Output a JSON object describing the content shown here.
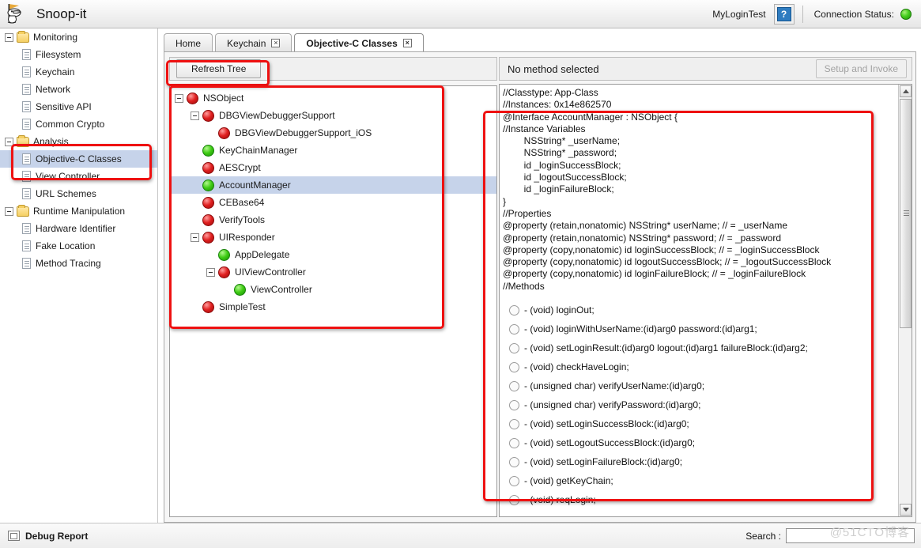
{
  "header": {
    "app_title": "Snoop-it",
    "logo_icon": "snoopy-dog-icon",
    "login_name": "MyLoginTest",
    "help_label": "?",
    "connection_label": "Connection Status:",
    "connection_state_color": "#45cf1e"
  },
  "sidebar": {
    "items": [
      {
        "label": "Monitoring",
        "type": "folder",
        "level": 0,
        "expanded": true,
        "selected": false
      },
      {
        "label": "Filesystem",
        "type": "doc",
        "level": 1,
        "expanded": false,
        "selected": false
      },
      {
        "label": "Keychain",
        "type": "doc",
        "level": 1,
        "expanded": false,
        "selected": false
      },
      {
        "label": "Network",
        "type": "doc",
        "level": 1,
        "expanded": false,
        "selected": false
      },
      {
        "label": "Sensitive API",
        "type": "doc",
        "level": 1,
        "expanded": false,
        "selected": false
      },
      {
        "label": "Common Crypto",
        "type": "doc",
        "level": 1,
        "expanded": false,
        "selected": false
      },
      {
        "label": "Analysis",
        "type": "folder",
        "level": 0,
        "expanded": true,
        "selected": false
      },
      {
        "label": "Objective-C Classes",
        "type": "doc",
        "level": 1,
        "expanded": false,
        "selected": true
      },
      {
        "label": "View Controller",
        "type": "doc",
        "level": 1,
        "expanded": false,
        "selected": false
      },
      {
        "label": "URL Schemes",
        "type": "doc",
        "level": 1,
        "expanded": false,
        "selected": false
      },
      {
        "label": "Runtime Manipulation",
        "type": "folder",
        "level": 0,
        "expanded": true,
        "selected": false
      },
      {
        "label": "Hardware Identifier",
        "type": "doc",
        "level": 1,
        "expanded": false,
        "selected": false
      },
      {
        "label": "Fake Location",
        "type": "doc",
        "level": 1,
        "expanded": false,
        "selected": false
      },
      {
        "label": "Method Tracing",
        "type": "doc",
        "level": 1,
        "expanded": false,
        "selected": false
      }
    ]
  },
  "tabs": [
    {
      "label": "Home",
      "closable": false,
      "active": false
    },
    {
      "label": "Keychain",
      "closable": true,
      "active": false
    },
    {
      "label": "Objective-C Classes",
      "closable": true,
      "active": true
    }
  ],
  "tab_close_glyph": "☒",
  "toolbar": {
    "refresh_tree_label": "Refresh Tree"
  },
  "class_tree": [
    {
      "label": "NSObject",
      "status": "red",
      "level": 0,
      "toggle": true,
      "selected": false
    },
    {
      "label": "DBGViewDebuggerSupport",
      "status": "red",
      "level": 1,
      "toggle": true,
      "selected": false
    },
    {
      "label": "DBGViewDebuggerSupport_iOS",
      "status": "red",
      "level": 2,
      "toggle": false,
      "selected": false
    },
    {
      "label": "KeyChainManager",
      "status": "green",
      "level": 1,
      "toggle": false,
      "selected": false
    },
    {
      "label": "AESCrypt",
      "status": "red",
      "level": 1,
      "toggle": false,
      "selected": false
    },
    {
      "label": "AccountManager",
      "status": "green",
      "level": 1,
      "toggle": false,
      "selected": true
    },
    {
      "label": "CEBase64",
      "status": "red",
      "level": 1,
      "toggle": false,
      "selected": false
    },
    {
      "label": "VerifyTools",
      "status": "red",
      "level": 1,
      "toggle": false,
      "selected": false
    },
    {
      "label": "UIResponder",
      "status": "red",
      "level": 1,
      "toggle": true,
      "selected": false
    },
    {
      "label": "AppDelegate",
      "status": "green",
      "level": 2,
      "toggle": false,
      "selected": false
    },
    {
      "label": "UIViewController",
      "status": "red",
      "level": 2,
      "toggle": true,
      "selected": false
    },
    {
      "label": "ViewController",
      "status": "green",
      "level": 3,
      "toggle": false,
      "selected": false
    },
    {
      "label": "SimpleTest",
      "status": "red",
      "level": 1,
      "toggle": false,
      "selected": false
    }
  ],
  "method_panel": {
    "status_text": "No method selected",
    "invoke_button_label": "Setup and Invoke",
    "invoke_button_enabled": false
  },
  "code": {
    "lines": [
      "//Classtype: App-Class",
      "//Instances: 0x14e862570",
      "@Interface AccountManager : NSObject {",
      "//Instance Variables",
      "",
      "        NSString* _userName;",
      "        NSString* _password;",
      "        id _loginSuccessBlock;",
      "        id _logoutSuccessBlock;",
      "        id _loginFailureBlock;",
      "}",
      "//Properties",
      "@property (retain,nonatomic) NSString* userName; // = _userName",
      "@property (retain,nonatomic) NSString* password; // = _password",
      "@property (copy,nonatomic) id loginSuccessBlock; // = _loginSuccessBlock",
      "@property (copy,nonatomic) id logoutSuccessBlock; // = _logoutSuccessBlock",
      "@property (copy,nonatomic) id loginFailureBlock; // = _loginFailureBlock",
      "//Methods"
    ]
  },
  "methods": [
    {
      "signature": "- (void) loginOut;",
      "selected": false
    },
    {
      "signature": "- (void) loginWithUserName:(id)arg0 password:(id)arg1;",
      "selected": false
    },
    {
      "signature": "- (void) setLoginResult:(id)arg0 logout:(id)arg1 failureBlock:(id)arg2;",
      "selected": false
    },
    {
      "signature": "- (void) checkHaveLogin;",
      "selected": false
    },
    {
      "signature": "- (unsigned char) verifyUserName:(id)arg0;",
      "selected": false
    },
    {
      "signature": "- (unsigned char) verifyPassword:(id)arg0;",
      "selected": false
    },
    {
      "signature": "- (void) setLoginSuccessBlock:(id)arg0;",
      "selected": false
    },
    {
      "signature": "- (void) setLogoutSuccessBlock:(id)arg0;",
      "selected": false
    },
    {
      "signature": "- (void) setLoginFailureBlock:(id)arg0;",
      "selected": false
    },
    {
      "signature": "- (void) getKeyChain;",
      "selected": false
    },
    {
      "signature": "- (void) reqLogin;",
      "selected": false
    }
  ],
  "footer": {
    "debug_report_label": "Debug Report",
    "search_label": "Search :",
    "search_value": "",
    "watermark": "@51CTO博客"
  },
  "annotations": {
    "highlight_color": "#ee1111",
    "boxes": [
      "sidebar-objective-c-classes",
      "refresh-tree-button",
      "class-tree-panel",
      "code-and-methods-panel"
    ]
  }
}
